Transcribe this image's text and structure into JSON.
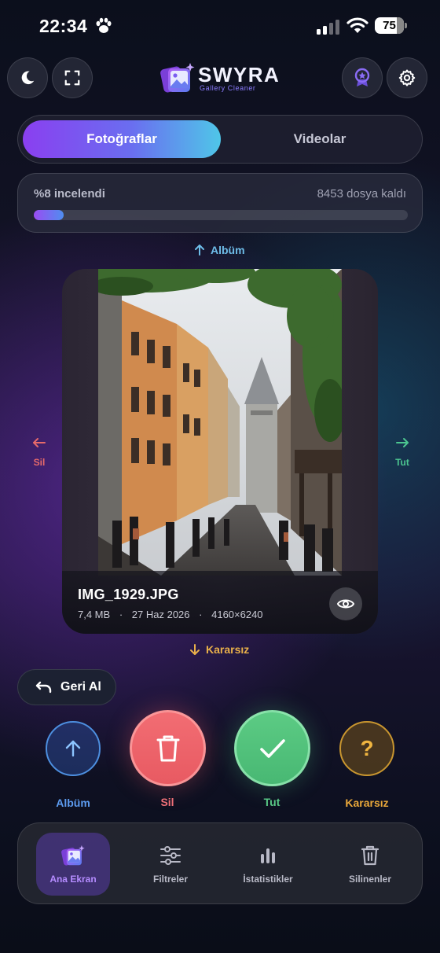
{
  "status_bar": {
    "time": "22:34",
    "battery": "75"
  },
  "header": {
    "logo_title": "SWYRA",
    "logo_subtitle": "Gallery Cleaner"
  },
  "tabs": {
    "photos": "Fotoğraflar",
    "videos": "Videolar",
    "active": "photos"
  },
  "progress": {
    "reviewed_label": "%8 incelendi",
    "remaining_label": "8453 dosya kaldı",
    "fraction": 0.08
  },
  "swipe_hints": {
    "up": "Albüm",
    "down": "Kararsız",
    "left": "Sil",
    "right": "Tut"
  },
  "photo": {
    "filename": "IMG_1929.JPG",
    "size": "7,4 MB",
    "date": "27 Haz 2026",
    "resolution": "4160×6240",
    "separator": "·"
  },
  "undo": {
    "label": "Geri Al"
  },
  "actions": {
    "album": "Albüm",
    "delete": "Sil",
    "keep": "Tut",
    "unsure": "Kararsız"
  },
  "nav": {
    "items": [
      "Ana Ekran",
      "Filtreler",
      "İstatistikler",
      "Silinenler"
    ],
    "active": "Ana Ekran"
  },
  "colors": {
    "accent_purple": "#8a3ff0",
    "accent_cyan": "#4fc6e8",
    "delete_red": "#f26d73",
    "keep_green": "#5ccb84",
    "unsure_amber": "#e9b04a",
    "album_blue": "#4d8fe0"
  }
}
